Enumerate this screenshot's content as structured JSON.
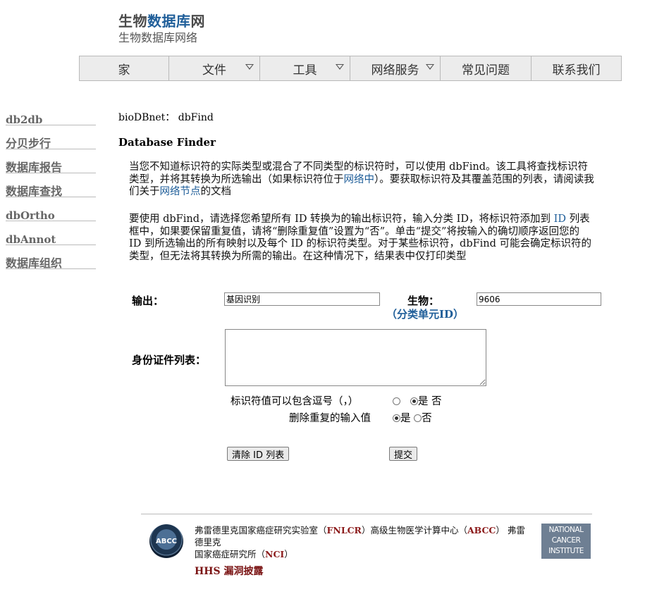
{
  "header": {
    "title_part1": "生物",
    "title_part2": "数据库",
    "title_part3": "网",
    "subtitle": "生物数据库网络"
  },
  "nav": {
    "items": [
      {
        "label": "家",
        "dropdown": false
      },
      {
        "label": "文件",
        "dropdown": true
      },
      {
        "label": "工具",
        "dropdown": true
      },
      {
        "label": "网络服务",
        "dropdown": true
      },
      {
        "label": "常见问题",
        "dropdown": false
      },
      {
        "label": "联系我们",
        "dropdown": false
      }
    ]
  },
  "sidebar": {
    "items": [
      "db2db",
      "分贝步行",
      "数据库报告",
      "数据库查找",
      "dbOrtho",
      "dbAnnot",
      "数据库组织"
    ]
  },
  "main": {
    "breadcrumb": "bioDBnet： dbFind",
    "heading": "Database Finder",
    "para1_a": "当您不知道标识符的实际类型或混合了不同类型的标识符时，可以使用 dbFind。该工具将查找标识符类型，并将其转换为所选输出（如果标识符位于",
    "para1_link1": "网络中",
    "para1_b": "）。要获取标识符及其覆盖范围的列表，请阅读我们关于",
    "para1_link2": "网络节点",
    "para1_c": "的文档",
    "para2_a": "要使用 dbFind，请选择您希望所有 ID 转换为的输出标识符，输入分类 ID，将标识符添加到 ",
    "para2_link": "ID",
    "para2_b": " 列表框中，如果要保留重复值，请将“删除重复值”设置为“否”。单击“提交”将按输入的确切顺序返回您的 ID 到所选输出的所有映射以及每个 ID 的标识符类型。对于某些标识符，dbFind 可能会确定标识符的类型，但无法将其转换为所需的输出。在这种情况下，结果表中仅打印类型"
  },
  "form": {
    "output_label": "输出：",
    "output_value": "基因识别",
    "organism_label": "生物：",
    "taxon_open": "（",
    "taxon_link": "分类单元ID",
    "taxon_close": "）",
    "organism_value": "9606",
    "idlist_label": "身份证件列表：",
    "comma_label": "标识符值可以包含逗号（，）",
    "comma_yes": "是",
    "comma_no": "否",
    "dup_label": "删除重复的输入值",
    "dup_yes": "是",
    "dup_no": "否",
    "clear_button": "清除 ID 列表",
    "submit_button": "提交"
  },
  "footer": {
    "abcc_logo": "ABCC",
    "line1_a": "弗雷德里克国家癌症研究实验室（",
    "line1_b": "FNLCR",
    "line1_c": "）高级生物医学计算中心（",
    "line1_d": "ABCC",
    "line1_e": "） 弗雷德里克",
    "line2_a": "国家癌症研究所（",
    "line2_b": "NCI",
    "line2_c": "）",
    "hhs": "HHS 漏洞披露",
    "nci_logo_1": "NATIONAL",
    "nci_logo_2": "CANCER",
    "nci_logo_3": "INSTITUTE"
  }
}
